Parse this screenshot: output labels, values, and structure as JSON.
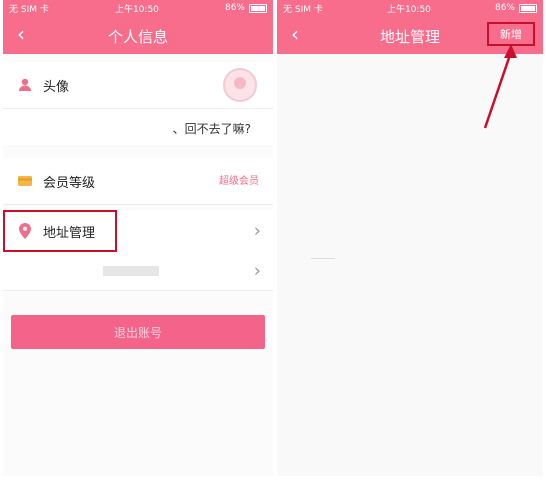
{
  "status_bar": {
    "carrier": "无 SIM 卡",
    "time": "上午10:50",
    "battery": "86%",
    "battery_fraction": 0.86
  },
  "left": {
    "title": "个人信息",
    "back_icon": "chevron-left-icon",
    "rows": {
      "avatar_label": "头像",
      "message": "、回不去了嘛?",
      "level_label": "会员等级",
      "level_value": "超级会员",
      "address_label": "地址管理"
    },
    "logout_label": "退出账号"
  },
  "right": {
    "title": "地址管理",
    "new_label": "新增",
    "back_icon": "chevron-left-icon"
  },
  "colors": {
    "brand": "#f86d8c",
    "highlight": "#c8102e",
    "button": "#f4638a"
  }
}
